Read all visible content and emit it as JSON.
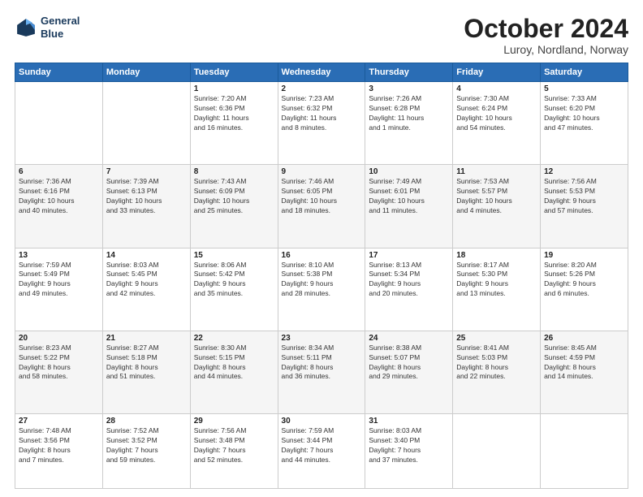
{
  "header": {
    "logo": {
      "line1": "General",
      "line2": "Blue"
    },
    "title": "October 2024",
    "subtitle": "Luroy, Nordland, Norway"
  },
  "weekdays": [
    "Sunday",
    "Monday",
    "Tuesday",
    "Wednesday",
    "Thursday",
    "Friday",
    "Saturday"
  ],
  "weeks": [
    [
      {
        "day": "",
        "info": ""
      },
      {
        "day": "",
        "info": ""
      },
      {
        "day": "1",
        "info": "Sunrise: 7:20 AM\nSunset: 6:36 PM\nDaylight: 11 hours\nand 16 minutes."
      },
      {
        "day": "2",
        "info": "Sunrise: 7:23 AM\nSunset: 6:32 PM\nDaylight: 11 hours\nand 8 minutes."
      },
      {
        "day": "3",
        "info": "Sunrise: 7:26 AM\nSunset: 6:28 PM\nDaylight: 11 hours\nand 1 minute."
      },
      {
        "day": "4",
        "info": "Sunrise: 7:30 AM\nSunset: 6:24 PM\nDaylight: 10 hours\nand 54 minutes."
      },
      {
        "day": "5",
        "info": "Sunrise: 7:33 AM\nSunset: 6:20 PM\nDaylight: 10 hours\nand 47 minutes."
      }
    ],
    [
      {
        "day": "6",
        "info": "Sunrise: 7:36 AM\nSunset: 6:16 PM\nDaylight: 10 hours\nand 40 minutes."
      },
      {
        "day": "7",
        "info": "Sunrise: 7:39 AM\nSunset: 6:13 PM\nDaylight: 10 hours\nand 33 minutes."
      },
      {
        "day": "8",
        "info": "Sunrise: 7:43 AM\nSunset: 6:09 PM\nDaylight: 10 hours\nand 25 minutes."
      },
      {
        "day": "9",
        "info": "Sunrise: 7:46 AM\nSunset: 6:05 PM\nDaylight: 10 hours\nand 18 minutes."
      },
      {
        "day": "10",
        "info": "Sunrise: 7:49 AM\nSunset: 6:01 PM\nDaylight: 10 hours\nand 11 minutes."
      },
      {
        "day": "11",
        "info": "Sunrise: 7:53 AM\nSunset: 5:57 PM\nDaylight: 10 hours\nand 4 minutes."
      },
      {
        "day": "12",
        "info": "Sunrise: 7:56 AM\nSunset: 5:53 PM\nDaylight: 9 hours\nand 57 minutes."
      }
    ],
    [
      {
        "day": "13",
        "info": "Sunrise: 7:59 AM\nSunset: 5:49 PM\nDaylight: 9 hours\nand 49 minutes."
      },
      {
        "day": "14",
        "info": "Sunrise: 8:03 AM\nSunset: 5:45 PM\nDaylight: 9 hours\nand 42 minutes."
      },
      {
        "day": "15",
        "info": "Sunrise: 8:06 AM\nSunset: 5:42 PM\nDaylight: 9 hours\nand 35 minutes."
      },
      {
        "day": "16",
        "info": "Sunrise: 8:10 AM\nSunset: 5:38 PM\nDaylight: 9 hours\nand 28 minutes."
      },
      {
        "day": "17",
        "info": "Sunrise: 8:13 AM\nSunset: 5:34 PM\nDaylight: 9 hours\nand 20 minutes."
      },
      {
        "day": "18",
        "info": "Sunrise: 8:17 AM\nSunset: 5:30 PM\nDaylight: 9 hours\nand 13 minutes."
      },
      {
        "day": "19",
        "info": "Sunrise: 8:20 AM\nSunset: 5:26 PM\nDaylight: 9 hours\nand 6 minutes."
      }
    ],
    [
      {
        "day": "20",
        "info": "Sunrise: 8:23 AM\nSunset: 5:22 PM\nDaylight: 8 hours\nand 58 minutes."
      },
      {
        "day": "21",
        "info": "Sunrise: 8:27 AM\nSunset: 5:18 PM\nDaylight: 8 hours\nand 51 minutes."
      },
      {
        "day": "22",
        "info": "Sunrise: 8:30 AM\nSunset: 5:15 PM\nDaylight: 8 hours\nand 44 minutes."
      },
      {
        "day": "23",
        "info": "Sunrise: 8:34 AM\nSunset: 5:11 PM\nDaylight: 8 hours\nand 36 minutes."
      },
      {
        "day": "24",
        "info": "Sunrise: 8:38 AM\nSunset: 5:07 PM\nDaylight: 8 hours\nand 29 minutes."
      },
      {
        "day": "25",
        "info": "Sunrise: 8:41 AM\nSunset: 5:03 PM\nDaylight: 8 hours\nand 22 minutes."
      },
      {
        "day": "26",
        "info": "Sunrise: 8:45 AM\nSunset: 4:59 PM\nDaylight: 8 hours\nand 14 minutes."
      }
    ],
    [
      {
        "day": "27",
        "info": "Sunrise: 7:48 AM\nSunset: 3:56 PM\nDaylight: 8 hours\nand 7 minutes."
      },
      {
        "day": "28",
        "info": "Sunrise: 7:52 AM\nSunset: 3:52 PM\nDaylight: 7 hours\nand 59 minutes."
      },
      {
        "day": "29",
        "info": "Sunrise: 7:56 AM\nSunset: 3:48 PM\nDaylight: 7 hours\nand 52 minutes."
      },
      {
        "day": "30",
        "info": "Sunrise: 7:59 AM\nSunset: 3:44 PM\nDaylight: 7 hours\nand 44 minutes."
      },
      {
        "day": "31",
        "info": "Sunrise: 8:03 AM\nSunset: 3:40 PM\nDaylight: 7 hours\nand 37 minutes."
      },
      {
        "day": "",
        "info": ""
      },
      {
        "day": "",
        "info": ""
      }
    ]
  ]
}
